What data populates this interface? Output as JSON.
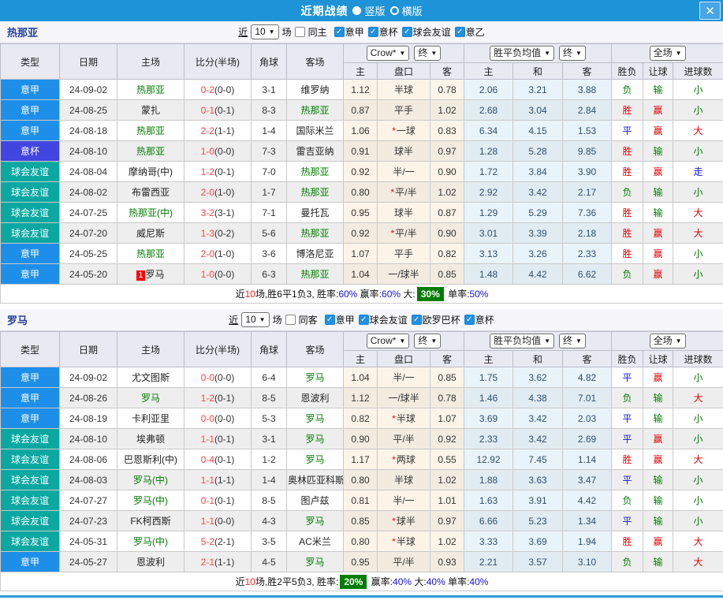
{
  "titlebar": {
    "title": "近期战绩",
    "radio_vertical": "竖版",
    "radio_horizontal": "横版",
    "close_glyph": "✕"
  },
  "colors": {
    "titlebar": "#1e93d8",
    "close_btn": "#47a6e6",
    "header_bg": "#e9e9f2",
    "row_even": "#eeeeee",
    "row_odd": "#ffffff",
    "odds_col": "#fdf4e9",
    "mean_col": "#e9f4fa",
    "team_selected": "#007d00",
    "score": "#ff4545",
    "red": "#e60000",
    "blue": "#1414dd",
    "green": "#007d00",
    "badge_bg": "#007d00",
    "rank_badge": "#ff0000",
    "bottom_line": "#2e9ad8"
  },
  "league_colors": {
    "意甲": "#1e8fe8",
    "意杯": "#4245e0",
    "球会友谊": "#0ba8a2"
  },
  "result_colors": {
    "胜": "red",
    "平": "blue",
    "负": "green",
    "赢": "red",
    "走": "blue",
    "输": "green",
    "大": "red",
    "小": "green"
  },
  "table_headers": {
    "type": "类型",
    "date": "日期",
    "home": "主场",
    "score": "比分(半场)",
    "corners": "角球",
    "away": "客场",
    "odds_company": "Crow*",
    "final1": "终",
    "avg_name": "胜平负均值",
    "final2": "终",
    "scope": "全场",
    "odds_home": "主",
    "odds_name": "盘口",
    "odds_away": "客",
    "avg_home": "主",
    "avg_draw": "和",
    "avg_away": "客",
    "res_wdl": "胜负",
    "res_handicap": "让球",
    "res_goals": "进球数"
  },
  "sections": [
    {
      "team": "热那亚",
      "filter": {
        "near_label": "近",
        "count": "10",
        "games_label": "场",
        "same_label": "同主",
        "same_checked": false,
        "leagues": [
          {
            "label": "意甲",
            "checked": true
          },
          {
            "label": "意杯",
            "checked": true
          },
          {
            "label": "球会友谊",
            "checked": true
          },
          {
            "label": "意乙",
            "checked": true
          }
        ]
      },
      "rows": [
        {
          "league": "意甲",
          "date": "24-09-02",
          "home": "热那亚",
          "home_sel": true,
          "badge": "",
          "score": "0-2",
          "half": "(0-0)",
          "corners": "3-1",
          "away": "维罗纳",
          "away_sel": false,
          "odds_home": "1.12",
          "handicap": "半球",
          "handicap_star": false,
          "odds_away": "0.78",
          "avg_win": "2.06",
          "avg_draw": "3.21",
          "avg_lose": "3.88",
          "result_wdl": "负",
          "result_handicap": "输",
          "result_goals": "小"
        },
        {
          "league": "意甲",
          "date": "24-08-25",
          "home": "蒙扎",
          "home_sel": false,
          "badge": "",
          "score": "0-1",
          "half": "(0-1)",
          "corners": "8-3",
          "away": "热那亚",
          "away_sel": true,
          "odds_home": "0.87",
          "handicap": "平手",
          "handicap_star": false,
          "odds_away": "1.02",
          "avg_win": "2.68",
          "avg_draw": "3.04",
          "avg_lose": "2.84",
          "result_wdl": "胜",
          "result_handicap": "赢",
          "result_goals": "小"
        },
        {
          "league": "意甲",
          "date": "24-08-18",
          "home": "热那亚",
          "home_sel": true,
          "badge": "",
          "score": "2-2",
          "half": "(1-1)",
          "corners": "1-4",
          "away": "国际米兰",
          "away_sel": false,
          "odds_home": "1.06",
          "handicap": "一球",
          "handicap_star": true,
          "odds_away": "0.83",
          "avg_win": "6.34",
          "avg_draw": "4.15",
          "avg_lose": "1.53",
          "result_wdl": "平",
          "result_handicap": "赢",
          "result_goals": "大"
        },
        {
          "league": "意杯",
          "date": "24-08-10",
          "home": "热那亚",
          "home_sel": true,
          "badge": "",
          "score": "1-0",
          "half": "(0-0)",
          "corners": "7-3",
          "away": "雷吉亚纳",
          "away_sel": false,
          "odds_home": "0.91",
          "handicap": "球半",
          "handicap_star": false,
          "odds_away": "0.97",
          "avg_win": "1.28",
          "avg_draw": "5.28",
          "avg_lose": "9.85",
          "result_wdl": "胜",
          "result_handicap": "输",
          "result_goals": "小"
        },
        {
          "league": "球会友谊",
          "date": "24-08-04",
          "home": "摩纳哥(中)",
          "home_sel": false,
          "badge": "",
          "score": "1-2",
          "half": "(0-1)",
          "corners": "7-0",
          "away": "热那亚",
          "away_sel": true,
          "odds_home": "0.92",
          "handicap": "半/一",
          "handicap_star": false,
          "odds_away": "0.90",
          "avg_win": "1.72",
          "avg_draw": "3.84",
          "avg_lose": "3.90",
          "result_wdl": "胜",
          "result_handicap": "赢",
          "result_goals": "走"
        },
        {
          "league": "球会友谊",
          "date": "24-08-02",
          "home": "布雷西亚",
          "home_sel": false,
          "badge": "",
          "score": "2-0",
          "half": "(1-0)",
          "corners": "1-7",
          "away": "热那亚",
          "away_sel": true,
          "odds_home": "0.80",
          "handicap": "平/半",
          "handicap_star": true,
          "odds_away": "1.02",
          "avg_win": "2.92",
          "avg_draw": "3.42",
          "avg_lose": "2.17",
          "result_wdl": "负",
          "result_handicap": "输",
          "result_goals": "小"
        },
        {
          "league": "球会友谊",
          "date": "24-07-25",
          "home": "热那亚(中)",
          "home_sel": true,
          "badge": "",
          "score": "3-2",
          "half": "(3-1)",
          "corners": "7-1",
          "away": "曼托瓦",
          "away_sel": false,
          "odds_home": "0.95",
          "handicap": "球半",
          "handicap_star": false,
          "odds_away": "0.87",
          "avg_win": "1.29",
          "avg_draw": "5.29",
          "avg_lose": "7.36",
          "result_wdl": "胜",
          "result_handicap": "输",
          "result_goals": "大"
        },
        {
          "league": "球会友谊",
          "date": "24-07-20",
          "home": "威尼斯",
          "home_sel": false,
          "badge": "",
          "score": "1-3",
          "half": "(0-2)",
          "corners": "5-6",
          "away": "热那亚",
          "away_sel": true,
          "odds_home": "0.92",
          "handicap": "平/半",
          "handicap_star": true,
          "odds_away": "0.90",
          "avg_win": "3.01",
          "avg_draw": "3.39",
          "avg_lose": "2.18",
          "result_wdl": "胜",
          "result_handicap": "赢",
          "result_goals": "大"
        },
        {
          "league": "意甲",
          "date": "24-05-25",
          "home": "热那亚",
          "home_sel": true,
          "badge": "",
          "score": "2-0",
          "half": "(1-0)",
          "corners": "3-6",
          "away": "博洛尼亚",
          "away_sel": false,
          "odds_home": "1.07",
          "handicap": "平手",
          "handicap_star": false,
          "odds_away": "0.82",
          "avg_win": "3.13",
          "avg_draw": "3.26",
          "avg_lose": "2.33",
          "result_wdl": "胜",
          "result_handicap": "赢",
          "result_goals": "小"
        },
        {
          "league": "意甲",
          "date": "24-05-20",
          "home": "罗马",
          "home_sel": false,
          "badge": "1",
          "score": "1-0",
          "half": "(0-0)",
          "corners": "6-3",
          "away": "热那亚",
          "away_sel": true,
          "odds_home": "1.04",
          "handicap": "一/球半",
          "handicap_star": false,
          "odds_away": "0.85",
          "avg_win": "1.48",
          "avg_draw": "4.42",
          "avg_lose": "6.62",
          "result_wdl": "负",
          "result_handicap": "赢",
          "result_goals": "小"
        }
      ],
      "summary": [
        {
          "text": "近",
          "style": "k"
        },
        {
          "text": "10",
          "style": "r"
        },
        {
          "text": "场,胜6平1负3, 胜率:",
          "style": "k"
        },
        {
          "text": "60%",
          "style": "b"
        },
        {
          "text": " 赢率:",
          "style": "k"
        },
        {
          "text": "60%",
          "style": "b"
        },
        {
          "text": " 大:",
          "style": "k"
        },
        {
          "text": "30%",
          "style": "badge"
        },
        {
          "text": " 单率:",
          "style": "k"
        },
        {
          "text": "50%",
          "style": "b"
        }
      ]
    },
    {
      "team": "罗马",
      "filter": {
        "near_label": "近",
        "count": "10",
        "games_label": "场",
        "same_label": "同客",
        "same_checked": false,
        "leagues": [
          {
            "label": "意甲",
            "checked": true
          },
          {
            "label": "球会友谊",
            "checked": true
          },
          {
            "label": "欧罗巴杯",
            "checked": true
          },
          {
            "label": "意杯",
            "checked": true
          }
        ]
      },
      "rows": [
        {
          "league": "意甲",
          "date": "24-09-02",
          "home": "尤文图斯",
          "home_sel": false,
          "badge": "",
          "score": "0-0",
          "half": "(0-0)",
          "corners": "6-4",
          "away": "罗马",
          "away_sel": true,
          "odds_home": "1.04",
          "handicap": "半/一",
          "handicap_star": false,
          "odds_away": "0.85",
          "avg_win": "1.75",
          "avg_draw": "3.62",
          "avg_lose": "4.82",
          "result_wdl": "平",
          "result_handicap": "赢",
          "result_goals": "小"
        },
        {
          "league": "意甲",
          "date": "24-08-26",
          "home": "罗马",
          "home_sel": true,
          "badge": "",
          "score": "1-2",
          "half": "(0-1)",
          "corners": "8-5",
          "away": "恩波利",
          "away_sel": false,
          "odds_home": "1.12",
          "handicap": "一/球半",
          "handicap_star": false,
          "odds_away": "0.78",
          "avg_win": "1.46",
          "avg_draw": "4.38",
          "avg_lose": "7.01",
          "result_wdl": "负",
          "result_handicap": "输",
          "result_goals": "大"
        },
        {
          "league": "意甲",
          "date": "24-08-19",
          "home": "卡利亚里",
          "home_sel": false,
          "badge": "",
          "score": "0-0",
          "half": "(0-0)",
          "corners": "5-3",
          "away": "罗马",
          "away_sel": true,
          "odds_home": "0.82",
          "handicap": "半球",
          "handicap_star": true,
          "odds_away": "1.07",
          "avg_win": "3.69",
          "avg_draw": "3.42",
          "avg_lose": "2.03",
          "result_wdl": "平",
          "result_handicap": "输",
          "result_goals": "小"
        },
        {
          "league": "球会友谊",
          "date": "24-08-10",
          "home": "埃弗顿",
          "home_sel": false,
          "badge": "",
          "score": "1-1",
          "half": "(0-1)",
          "corners": "3-1",
          "away": "罗马",
          "away_sel": true,
          "odds_home": "0.90",
          "handicap": "平/半",
          "handicap_star": false,
          "odds_away": "0.92",
          "avg_win": "2.33",
          "avg_draw": "3.42",
          "avg_lose": "2.69",
          "result_wdl": "平",
          "result_handicap": "赢",
          "result_goals": "小"
        },
        {
          "league": "球会友谊",
          "date": "24-08-06",
          "home": "巴恩斯利(中)",
          "home_sel": false,
          "badge": "",
          "score": "0-4",
          "half": "(0-1)",
          "corners": "1-2",
          "away": "罗马",
          "away_sel": true,
          "odds_home": "1.17",
          "handicap": "两球",
          "handicap_star": true,
          "odds_away": "0.55",
          "avg_win": "12.92",
          "avg_draw": "7.45",
          "avg_lose": "1.14",
          "result_wdl": "胜",
          "result_handicap": "赢",
          "result_goals": "大"
        },
        {
          "league": "球会友谊",
          "date": "24-08-03",
          "home": "罗马(中)",
          "home_sel": true,
          "badge": "",
          "score": "1-1",
          "half": "(1-1)",
          "corners": "1-4",
          "away": "奥林匹亚科斯",
          "away_sel": false,
          "odds_home": "0.80",
          "handicap": "半球",
          "handicap_star": false,
          "odds_away": "1.02",
          "avg_win": "1.88",
          "avg_draw": "3.63",
          "avg_lose": "3.47",
          "result_wdl": "平",
          "result_handicap": "输",
          "result_goals": "小"
        },
        {
          "league": "球会友谊",
          "date": "24-07-27",
          "home": "罗马(中)",
          "home_sel": true,
          "badge": "",
          "score": "0-1",
          "half": "(0-1)",
          "corners": "8-5",
          "away": "图卢兹",
          "away_sel": false,
          "odds_home": "0.81",
          "handicap": "半/一",
          "handicap_star": false,
          "odds_away": "1.01",
          "avg_win": "1.63",
          "avg_draw": "3.91",
          "avg_lose": "4.42",
          "result_wdl": "负",
          "result_handicap": "输",
          "result_goals": "小"
        },
        {
          "league": "球会友谊",
          "date": "24-07-23",
          "home": "FK柯西斯",
          "home_sel": false,
          "badge": "",
          "score": "1-1",
          "half": "(0-0)",
          "corners": "4-3",
          "away": "罗马",
          "away_sel": true,
          "odds_home": "0.85",
          "handicap": "球半",
          "handicap_star": true,
          "odds_away": "0.97",
          "avg_win": "6.66",
          "avg_draw": "5.23",
          "avg_lose": "1.34",
          "result_wdl": "平",
          "result_handicap": "输",
          "result_goals": "小"
        },
        {
          "league": "球会友谊",
          "date": "24-05-31",
          "home": "罗马(中)",
          "home_sel": true,
          "badge": "",
          "score": "5-2",
          "half": "(2-1)",
          "corners": "3-5",
          "away": "AC米兰",
          "away_sel": false,
          "odds_home": "0.80",
          "handicap": "半球",
          "handicap_star": true,
          "odds_away": "1.02",
          "avg_win": "3.33",
          "avg_draw": "3.69",
          "avg_lose": "1.94",
          "result_wdl": "胜",
          "result_handicap": "赢",
          "result_goals": "大"
        },
        {
          "league": "意甲",
          "date": "24-05-27",
          "home": "恩波利",
          "home_sel": false,
          "badge": "",
          "score": "2-1",
          "half": "(1-1)",
          "corners": "4-5",
          "away": "罗马",
          "away_sel": true,
          "odds_home": "0.95",
          "handicap": "平/半",
          "handicap_star": false,
          "odds_away": "0.93",
          "avg_win": "2.21",
          "avg_draw": "3.57",
          "avg_lose": "3.10",
          "result_wdl": "负",
          "result_handicap": "输",
          "result_goals": "大"
        }
      ],
      "summary": [
        {
          "text": "近",
          "style": "k"
        },
        {
          "text": "10",
          "style": "r"
        },
        {
          "text": "场,胜2平5负3, 胜率:",
          "style": "k"
        },
        {
          "text": "20%",
          "style": "badge"
        },
        {
          "text": " 赢率:",
          "style": "k"
        },
        {
          "text": "40%",
          "style": "b"
        },
        {
          "text": " 大:",
          "style": "k"
        },
        {
          "text": "40%",
          "style": "b"
        },
        {
          "text": " 单率:",
          "style": "k"
        },
        {
          "text": "40%",
          "style": "b"
        }
      ]
    }
  ]
}
